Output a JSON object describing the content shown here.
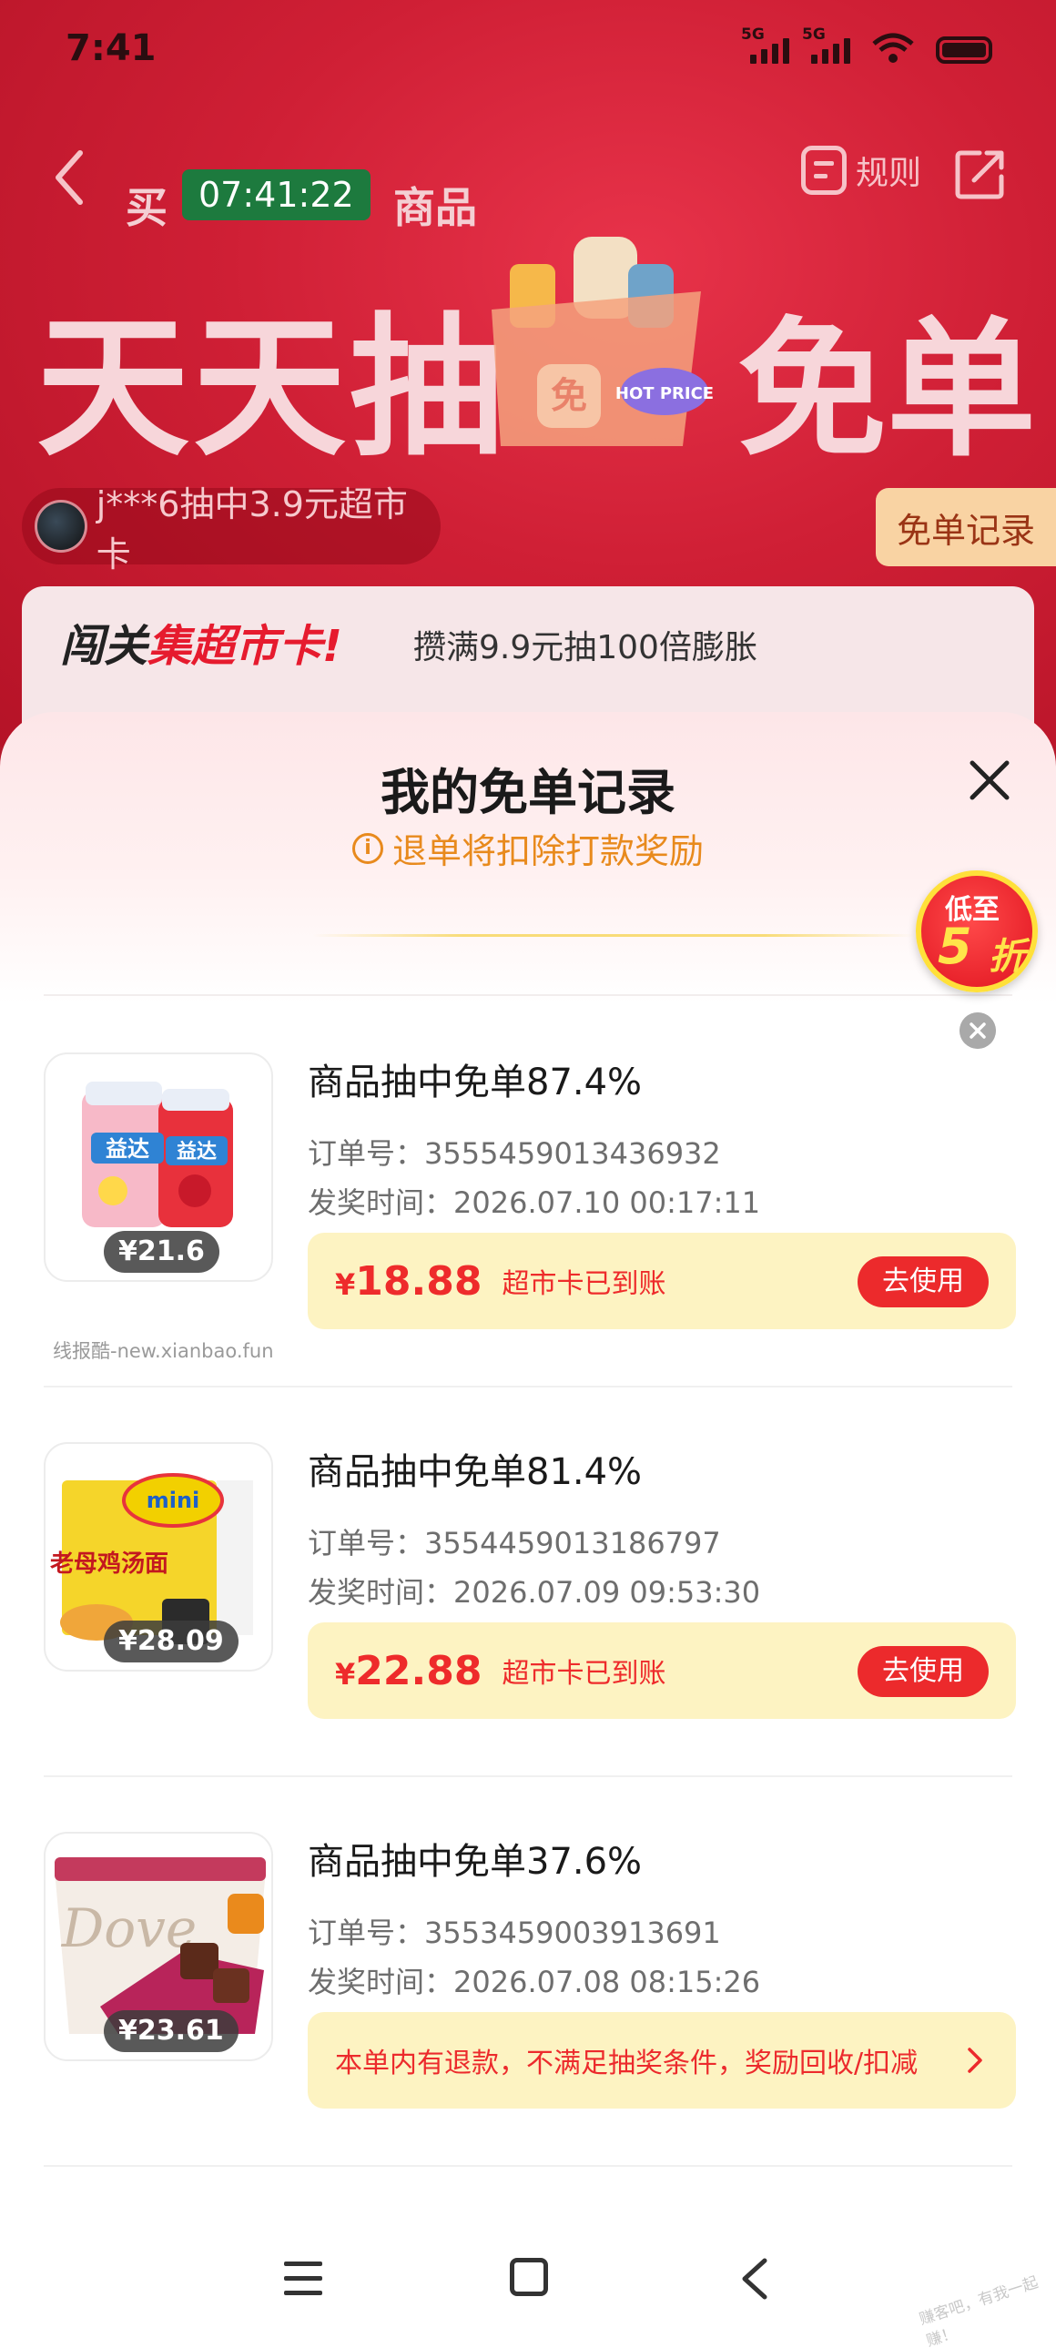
{
  "status_bar": {
    "time": "7:41",
    "net1": "5G",
    "net2": "5G"
  },
  "header": {
    "rule_label": "规则",
    "buy_prefix": "买",
    "buy_suffix": "商品",
    "timer": "07:41:22"
  },
  "banner": {
    "headline_left": "天天抽",
    "headline_right": "免单",
    "bag_badge": "免",
    "hot_badge": "HOT PRICE"
  },
  "winner": {
    "text": "j***6抽中3.9元超市卡"
  },
  "record_tab": {
    "label": "免单记录"
  },
  "promo": {
    "title_prefix": "闯关",
    "title_highlight": "集超市卡!",
    "subtitle": "攒满9.9元抽100倍膨胀"
  },
  "sheet": {
    "title": "我的免单记录",
    "notice": "退单将扣除打款奖励"
  },
  "float_promo": {
    "line1": "低至",
    "num": "5",
    "unit": "折"
  },
  "records": [
    {
      "title": "商品抽中免单87.4%",
      "order_label": "订单号：",
      "order_no": "3555459013436932",
      "time_label": "发奖时间：",
      "time": "2026.07.10 00:17:11",
      "price": "¥21.6",
      "currency": "¥",
      "amount": "18.88",
      "status": "超市卡已到账",
      "button": "去使用"
    },
    {
      "title": "商品抽中免单81.4%",
      "order_label": "订单号：",
      "order_no": "3554459013186797",
      "time_label": "发奖时间：",
      "time": "2026.07.09 09:53:30",
      "price": "¥28.09",
      "currency": "¥",
      "amount": "22.88",
      "status": "超市卡已到账",
      "button": "去使用"
    },
    {
      "title": "商品抽中免单37.6%",
      "order_label": "订单号：",
      "order_no": "3553459003913691",
      "time_label": "发奖时间：",
      "time": "2026.07.08 08:15:26",
      "price": "¥23.61",
      "refund_notice": "本单内有退款，不满足抽奖条件，奖励回收/扣减"
    }
  ],
  "product_labels": {
    "yida": "益达",
    "mini": "mini",
    "noodle": "老母鸡汤面",
    "dove": "Dove"
  },
  "watermark": "线报酷-new.xianbao.fun",
  "corner_mark": "赚客吧，有我一起赚！",
  "colors": {
    "accent_red": "#ec2a2c",
    "banner_red": "#cf1f35",
    "reward_bg": "#fdf3c2",
    "notice_orange": "#e88a1d"
  }
}
